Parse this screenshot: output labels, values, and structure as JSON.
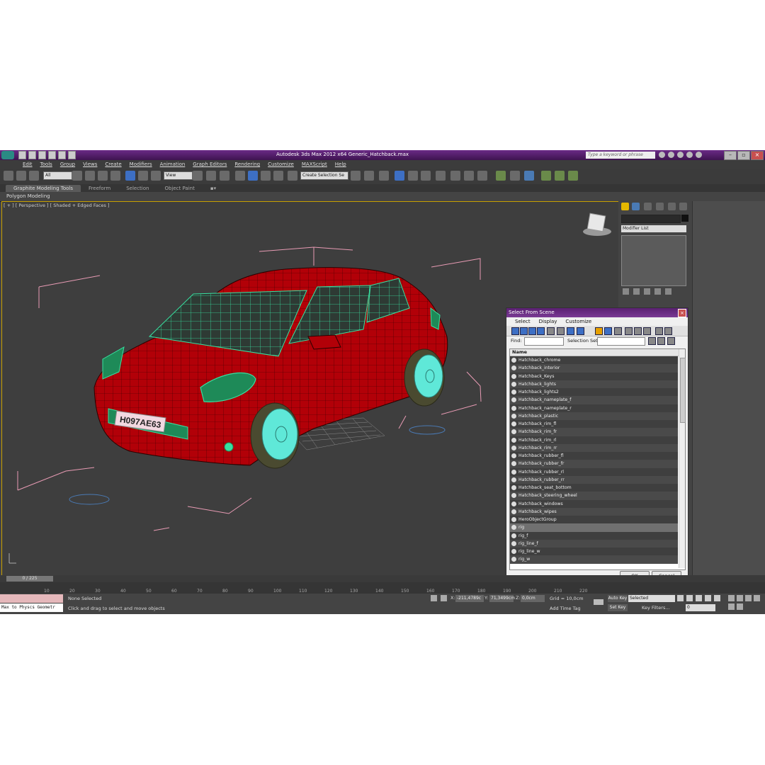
{
  "window": {
    "title": "Autodesk 3ds Max  2012 x64     Generic_Hatchback.max",
    "search_placeholder": "Type a keyword or phrase"
  },
  "menu": [
    "Edit",
    "Tools",
    "Group",
    "Views",
    "Create",
    "Modifiers",
    "Animation",
    "Graph Editors",
    "Rendering",
    "Customize",
    "MAXScript",
    "Help"
  ],
  "toolbar": {
    "filter_value": "All",
    "refcoord_value": "View",
    "named_selection_value": "Create Selection Se"
  },
  "ribbon": {
    "tabs": [
      "Graphite Modeling Tools",
      "Freeform",
      "Selection",
      "Object Paint"
    ],
    "sub_label": "Polygon Modeling"
  },
  "viewport": {
    "label": "[ + ] [ Perspective ] [ Shaded + Edged Faces ]",
    "plate_text": "H097AE63"
  },
  "command_panel": {
    "modifier_list": "Modifier List"
  },
  "dialog": {
    "title": "Select From Scene",
    "menu": [
      "Select",
      "Display",
      "Customize"
    ],
    "find_label": "Find:",
    "selection_set_label": "Selection Set:",
    "column_header": "Name",
    "items": [
      "Hatchback_chrome",
      "Hatchback_interior",
      "Hatchback_Keys",
      "Hatchback_lights",
      "Hatchback_lights2",
      "Hatchback_nameplate_f",
      "Hatchback_nameplate_r",
      "Hatchback_plastic",
      "Hatchback_rim_fl",
      "Hatchback_rim_fr",
      "Hatchback_rim_rl",
      "Hatchback_rim_rr",
      "Hatchback_rubber_fl",
      "Hatchback_rubber_fr",
      "Hatchback_rubber_rl",
      "Hatchback_rubber_rr",
      "Hatchback_seat_bottom",
      "Hatchback_steering_wheel",
      "Hatchback_windows",
      "Hatchback_wipes",
      "HeroObjectGroup",
      "rig",
      "rig_f",
      "rig_line_f",
      "rig_line_w",
      "rig_w"
    ],
    "ok_label": "OK",
    "cancel_label": "Cancel"
  },
  "timeline": {
    "slider": "0 / 225",
    "ticks": [
      "10",
      "20",
      "30",
      "40",
      "50",
      "60",
      "70",
      "80",
      "90",
      "100",
      "110",
      "120",
      "130",
      "140",
      "150",
      "160",
      "170",
      "180",
      "190",
      "200",
      "210",
      "220"
    ]
  },
  "status": {
    "maxscript_line": "Max to Physcs Geometr",
    "selection": "None Selected",
    "hint": "Click and drag to select and move objects",
    "x_label": "X:",
    "x_value": "-211,4789c",
    "y_label": "Y:",
    "y_value": "71,3499cm",
    "z_label": "Z:",
    "z_value": "0,0cm",
    "grid": "Grid = 10,0cm",
    "add_time_tag": "Add Time Tag",
    "auto_key": "Auto Key",
    "set_key": "Set Key",
    "key_mode_value": "Selected",
    "key_filters": "Key Filters...",
    "frame_value": "0"
  },
  "colors": {
    "title_bar": "#4e1c66",
    "car_body": "#b20008",
    "car_wire_glass": "#38e0a0",
    "bbox": "#e89bb4"
  }
}
